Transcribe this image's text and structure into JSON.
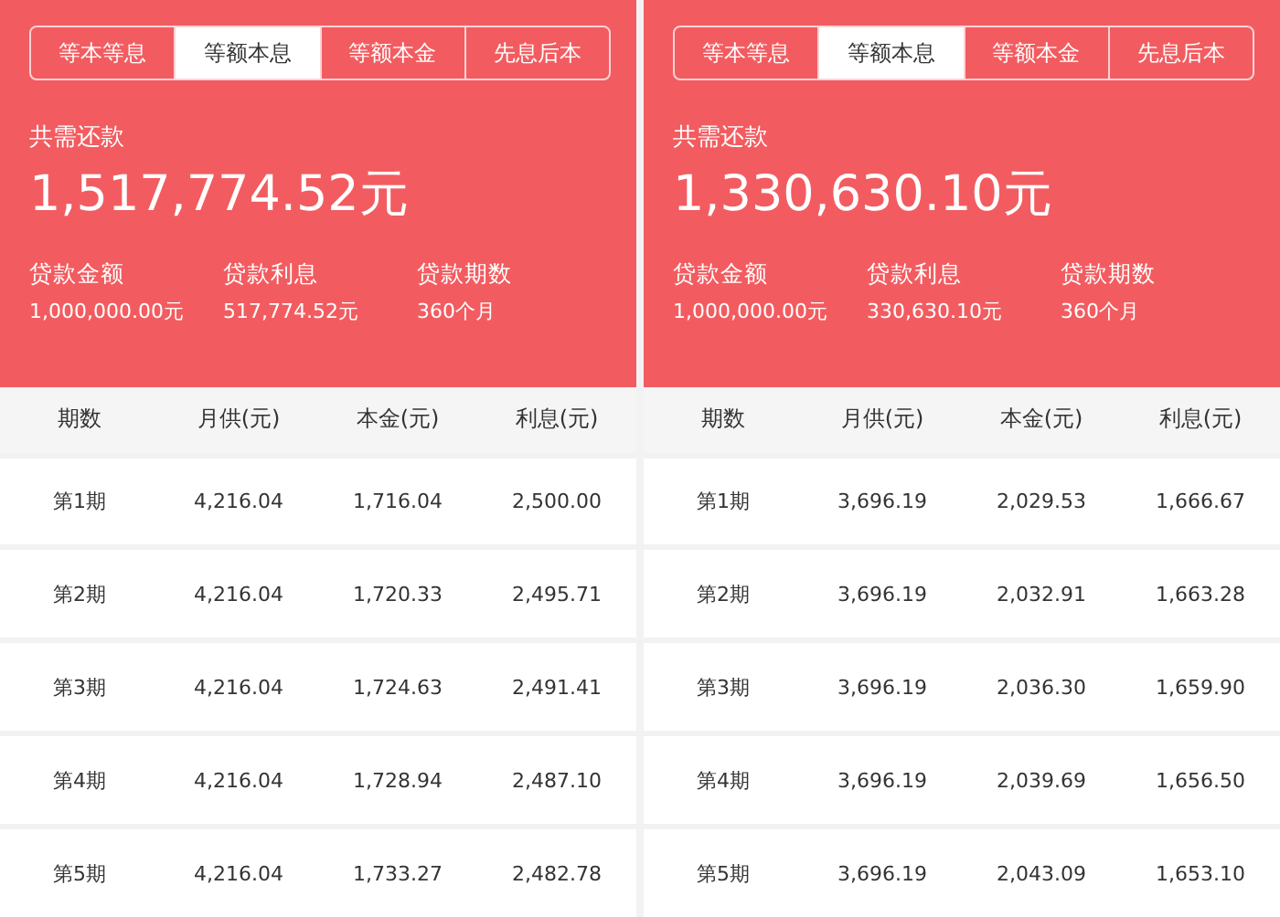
{
  "panels": [
    {
      "tabs": [
        {
          "label": "等本等息",
          "selected": false
        },
        {
          "label": "等额本息",
          "selected": true
        },
        {
          "label": "等额本金",
          "selected": false
        },
        {
          "label": "先息后本",
          "selected": false
        }
      ],
      "total_label": "共需还款",
      "total": "1,517,774.52元",
      "stats": [
        {
          "label": "贷款金额",
          "value": "1,000,000.00元"
        },
        {
          "label": "贷款利息",
          "value": "517,774.52元"
        },
        {
          "label": "贷款期数",
          "value": "360个月"
        }
      ],
      "columns": [
        "期数",
        "月供(元)",
        "本金(元)",
        "利息(元)"
      ],
      "rows": [
        [
          "第1期",
          "4,216.04",
          "1,716.04",
          "2,500.00"
        ],
        [
          "第2期",
          "4,216.04",
          "1,720.33",
          "2,495.71"
        ],
        [
          "第3期",
          "4,216.04",
          "1,724.63",
          "2,491.41"
        ],
        [
          "第4期",
          "4,216.04",
          "1,728.94",
          "2,487.10"
        ],
        [
          "第5期",
          "4,216.04",
          "1,733.27",
          "2,482.78"
        ]
      ]
    },
    {
      "tabs": [
        {
          "label": "等本等息",
          "selected": false
        },
        {
          "label": "等额本息",
          "selected": true
        },
        {
          "label": "等额本金",
          "selected": false
        },
        {
          "label": "先息后本",
          "selected": false
        }
      ],
      "total_label": "共需还款",
      "total": "1,330,630.10元",
      "stats": [
        {
          "label": "贷款金额",
          "value": "1,000,000.00元"
        },
        {
          "label": "贷款利息",
          "value": "330,630.10元"
        },
        {
          "label": "贷款期数",
          "value": "360个月"
        }
      ],
      "columns": [
        "期数",
        "月供(元)",
        "本金(元)",
        "利息(元)"
      ],
      "rows": [
        [
          "第1期",
          "3,696.19",
          "2,029.53",
          "1,666.67"
        ],
        [
          "第2期",
          "3,696.19",
          "2,032.91",
          "1,663.28"
        ],
        [
          "第3期",
          "3,696.19",
          "2,036.30",
          "1,659.90"
        ],
        [
          "第4期",
          "3,696.19",
          "2,039.69",
          "1,656.50"
        ],
        [
          "第5期",
          "3,696.19",
          "2,043.09",
          "1,653.10"
        ]
      ]
    }
  ]
}
